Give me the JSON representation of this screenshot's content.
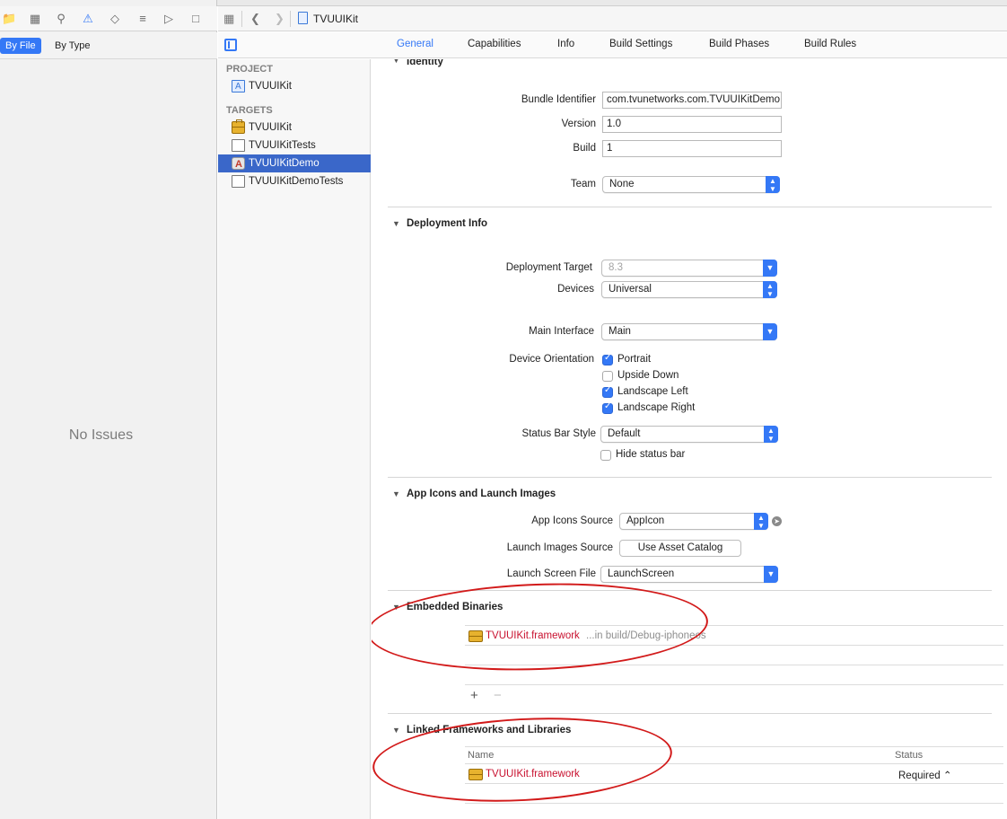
{
  "navigator": {
    "scope_by_file": "By File",
    "scope_by_type": "By Type",
    "empty_message": "No Issues"
  },
  "jumpbar": {
    "title": "TVUUIKit"
  },
  "tabs": [
    "General",
    "Capabilities",
    "Info",
    "Build Settings",
    "Build Phases",
    "Build Rules"
  ],
  "project_list": {
    "project_header": "PROJECT",
    "project_name": "TVUUIKit",
    "targets_header": "TARGETS",
    "targets": [
      "TVUUIKit",
      "TVUUIKitTests",
      "TVUUIKitDemo",
      "TVUUIKitDemoTests"
    ],
    "selected_target": "TVUUIKitDemo"
  },
  "identity": {
    "title": "Identity",
    "bundle_identifier_label": "Bundle Identifier",
    "bundle_identifier": "com.tvunetworks.com.TVUUIKitDemo",
    "version_label": "Version",
    "version": "1.0",
    "build_label": "Build",
    "build": "1",
    "team_label": "Team",
    "team": "None"
  },
  "deployment": {
    "title": "Deployment Info",
    "target_label": "Deployment Target",
    "target": "8.3",
    "devices_label": "Devices",
    "devices": "Universal",
    "main_interface_label": "Main Interface",
    "main_interface": "Main",
    "orientation_label": "Device Orientation",
    "orientations": [
      {
        "label": "Portrait",
        "checked": true
      },
      {
        "label": "Upside Down",
        "checked": false
      },
      {
        "label": "Landscape Left",
        "checked": true
      },
      {
        "label": "Landscape Right",
        "checked": true
      }
    ],
    "status_bar_style_label": "Status Bar Style",
    "status_bar_style": "Default",
    "hide_status_bar": "Hide status bar"
  },
  "app_icons": {
    "title": "App Icons and Launch Images",
    "icons_source_label": "App Icons Source",
    "icons_source": "AppIcon",
    "launch_images_label": "Launch Images Source",
    "launch_images_button": "Use Asset Catalog",
    "launch_screen_label": "Launch Screen File",
    "launch_screen": "LaunchScreen"
  },
  "embedded": {
    "title": "Embedded Binaries",
    "item_name": "TVUUIKit.framework",
    "item_path": "...in build/Debug-iphoneos",
    "plus": "+",
    "minus": "−"
  },
  "linked": {
    "title": "Linked Frameworks and Libraries",
    "col_name": "Name",
    "col_status": "Status",
    "item_name": "TVUUIKit.framework",
    "item_status": "Required ⌃"
  },
  "colors": {
    "accent": "#3478f6",
    "selection": "#3a67c9",
    "annotation": "#d21a1a",
    "missing_file": "#c8102e"
  }
}
